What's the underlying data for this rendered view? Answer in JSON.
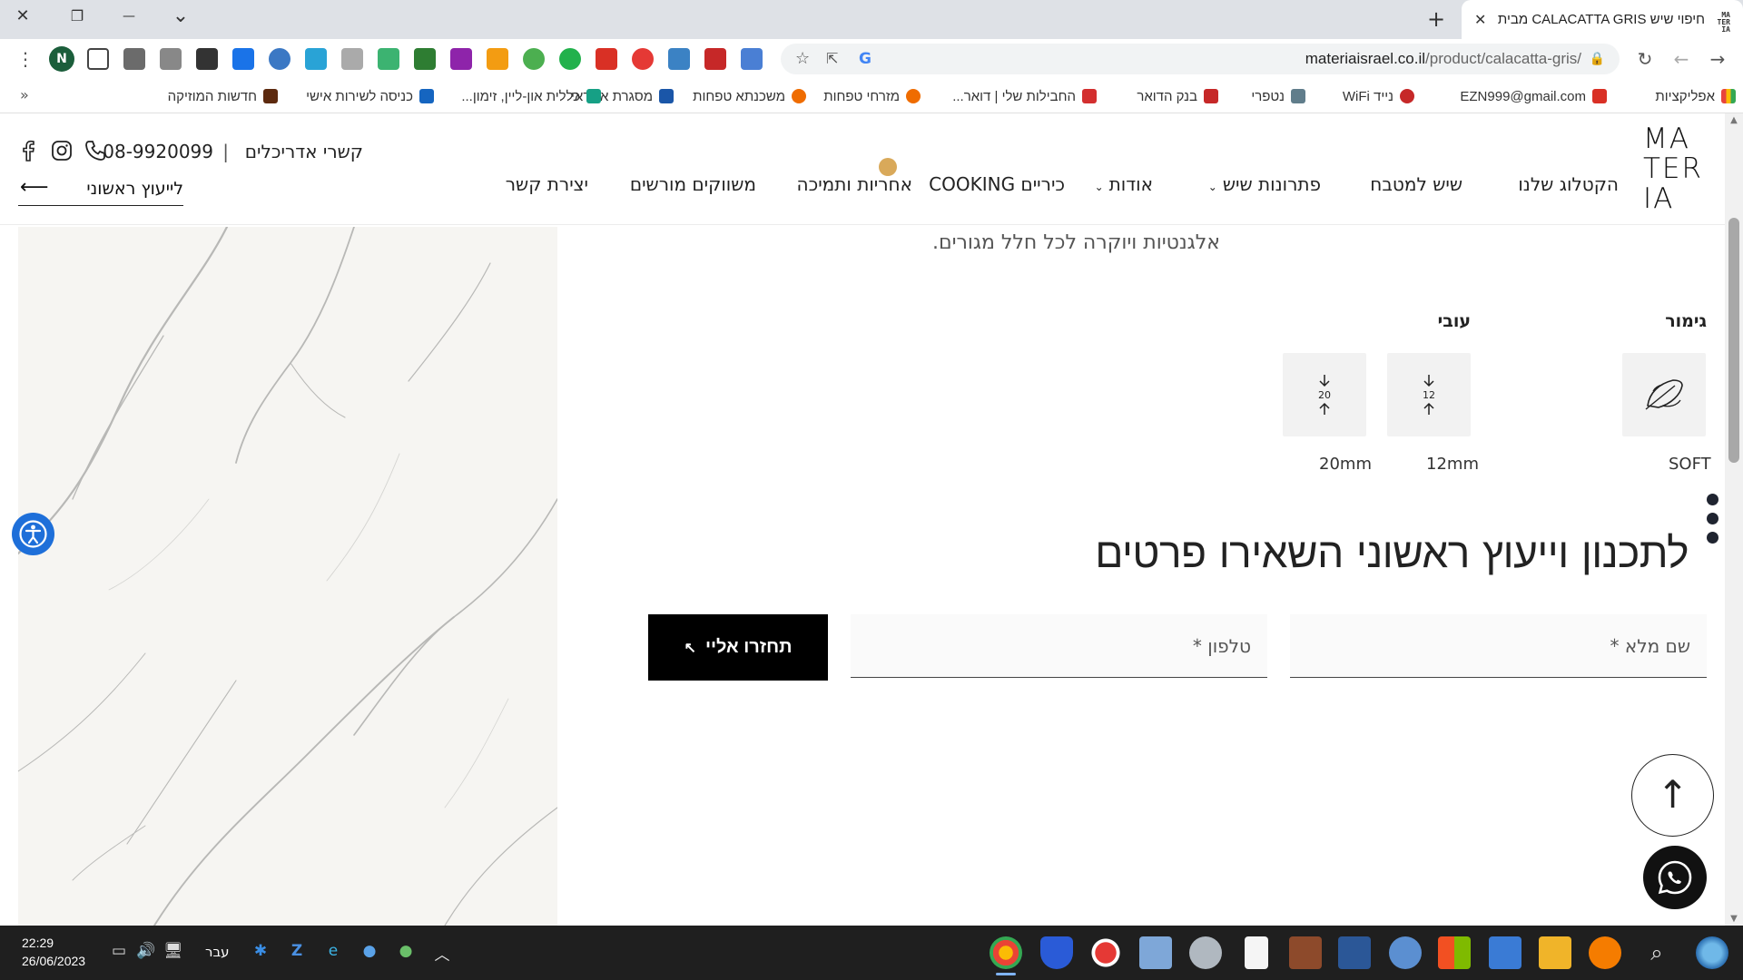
{
  "browser": {
    "tab_title": "חיפוי שיש CALACATTA GRIS מבית",
    "tab_close": "✕",
    "new_tab": "+",
    "window_controls": {
      "close": "✕",
      "restore": "❐",
      "minimize": "—",
      "tabsearch": "⌄"
    },
    "url_domain": "materiaisrael.co.il",
    "url_path": "/product/calacatta-gris/",
    "nav": {
      "back": "←",
      "forward": "→",
      "reload": "↻"
    },
    "menu": "⋮",
    "profile_initial": "N",
    "bookmarks_more": "»",
    "bookmarks": [
      {
        "label": "אפליקציות",
        "color": "#e8453c"
      },
      {
        "label": "EZN999@gmail.com",
        "color": "#d93025"
      },
      {
        "label": "נייד WiFi",
        "color": "#c62828"
      },
      {
        "label": "נטפרי",
        "color": "#607d8b"
      },
      {
        "label": "בנק הדואר",
        "color": "#c62828"
      },
      {
        "label": "החבילות שלי | דואר...",
        "color": "#d32f2f"
      },
      {
        "label": "מזרחי טפחות",
        "color": "#ef6c00"
      },
      {
        "label": "משכנתא טפחות",
        "color": "#ef6c00"
      },
      {
        "label": "מסגרת אשראי",
        "color": "#1a56a8"
      },
      {
        "label": "כללית און-ליין, זימון...",
        "color": "#16a085"
      },
      {
        "label": "כניסה לשירות אישי",
        "color": "#1565c0"
      },
      {
        "label": "חדשות המוזיקה",
        "color": "#5d2a0f"
      }
    ]
  },
  "site": {
    "logo_lines": [
      "MA",
      "TER",
      "IA"
    ],
    "nav": [
      {
        "label": "הקטלוג שלנו"
      },
      {
        "label": "שיש למטבח"
      },
      {
        "label": "פתרונות שיש",
        "caret": "⌄"
      },
      {
        "label": "אודות",
        "caret": "⌄"
      },
      {
        "label": "כיריים COOKING"
      },
      {
        "label": "אחריות ותמיכה"
      },
      {
        "label": "משווקים מורשים"
      },
      {
        "label": "יצירת קשר"
      }
    ],
    "top_info": {
      "architects": "קשרי אדריכלים",
      "separator": "|",
      "phone": "08-9920099"
    },
    "consult_cta": "לייעוץ ראשוני",
    "consult_arrow": "⟵"
  },
  "product": {
    "description_tail": "אלגנטיות ויוקרה לכל חלל מגורים.",
    "finish_label": "גימור",
    "thickness_label": "עובי",
    "finish_value": "SOFT",
    "thickness_options": [
      {
        "value": "12mm",
        "code": "12"
      },
      {
        "value": "20mm",
        "code": "20"
      }
    ]
  },
  "form": {
    "heading": "לתכנון וייעוץ ראשוני השאירו פרטים",
    "name_placeholder": "שם מלא *",
    "phone_placeholder": "טלפון *",
    "submit_label": "תחזרו אליי",
    "submit_arrow": "↖"
  },
  "floating": {
    "to_top": "↑"
  },
  "taskbar": {
    "time": "22:29",
    "date": "26/06/2023",
    "lang": "עבר",
    "tray_expand": "︿"
  },
  "colors": {
    "accent_dot": "#d9a95a",
    "button_bg": "#000000",
    "accessibility": "#1e6fd9",
    "taskbar": "#1f1f1f"
  }
}
